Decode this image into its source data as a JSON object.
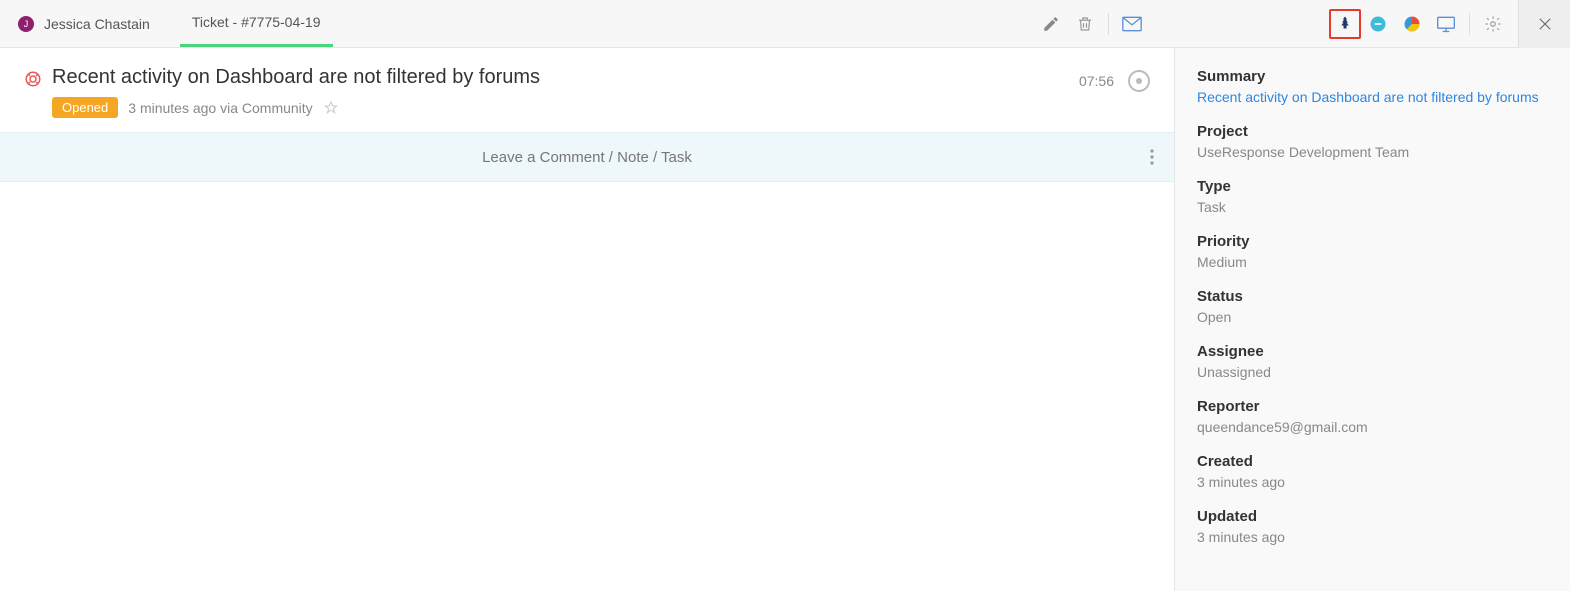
{
  "header": {
    "user_initial": "J",
    "user_name": "Jessica Chastain",
    "tab_label": "Ticket - #7775-04-19"
  },
  "ticket": {
    "title": "Recent activity on Dashboard are not filtered by forums",
    "status_badge": "Opened",
    "meta": "3 minutes ago via Community",
    "time": "07:56"
  },
  "comment_bar": {
    "placeholder": "Leave a Comment / Note / Task"
  },
  "sidebar": {
    "summary": {
      "label": "Summary",
      "value": "Recent activity on Dashboard are not filtered by forums"
    },
    "project": {
      "label": "Project",
      "value": "UseResponse Development Team"
    },
    "type": {
      "label": "Type",
      "value": "Task"
    },
    "priority": {
      "label": "Priority",
      "value": "Medium"
    },
    "status": {
      "label": "Status",
      "value": "Open"
    },
    "assignee": {
      "label": "Assignee",
      "value": "Unassigned"
    },
    "reporter": {
      "label": "Reporter",
      "value": "queendance59@gmail.com"
    },
    "created": {
      "label": "Created",
      "value": "3 minutes ago"
    },
    "updated": {
      "label": "Updated",
      "value": "3 minutes ago"
    }
  }
}
